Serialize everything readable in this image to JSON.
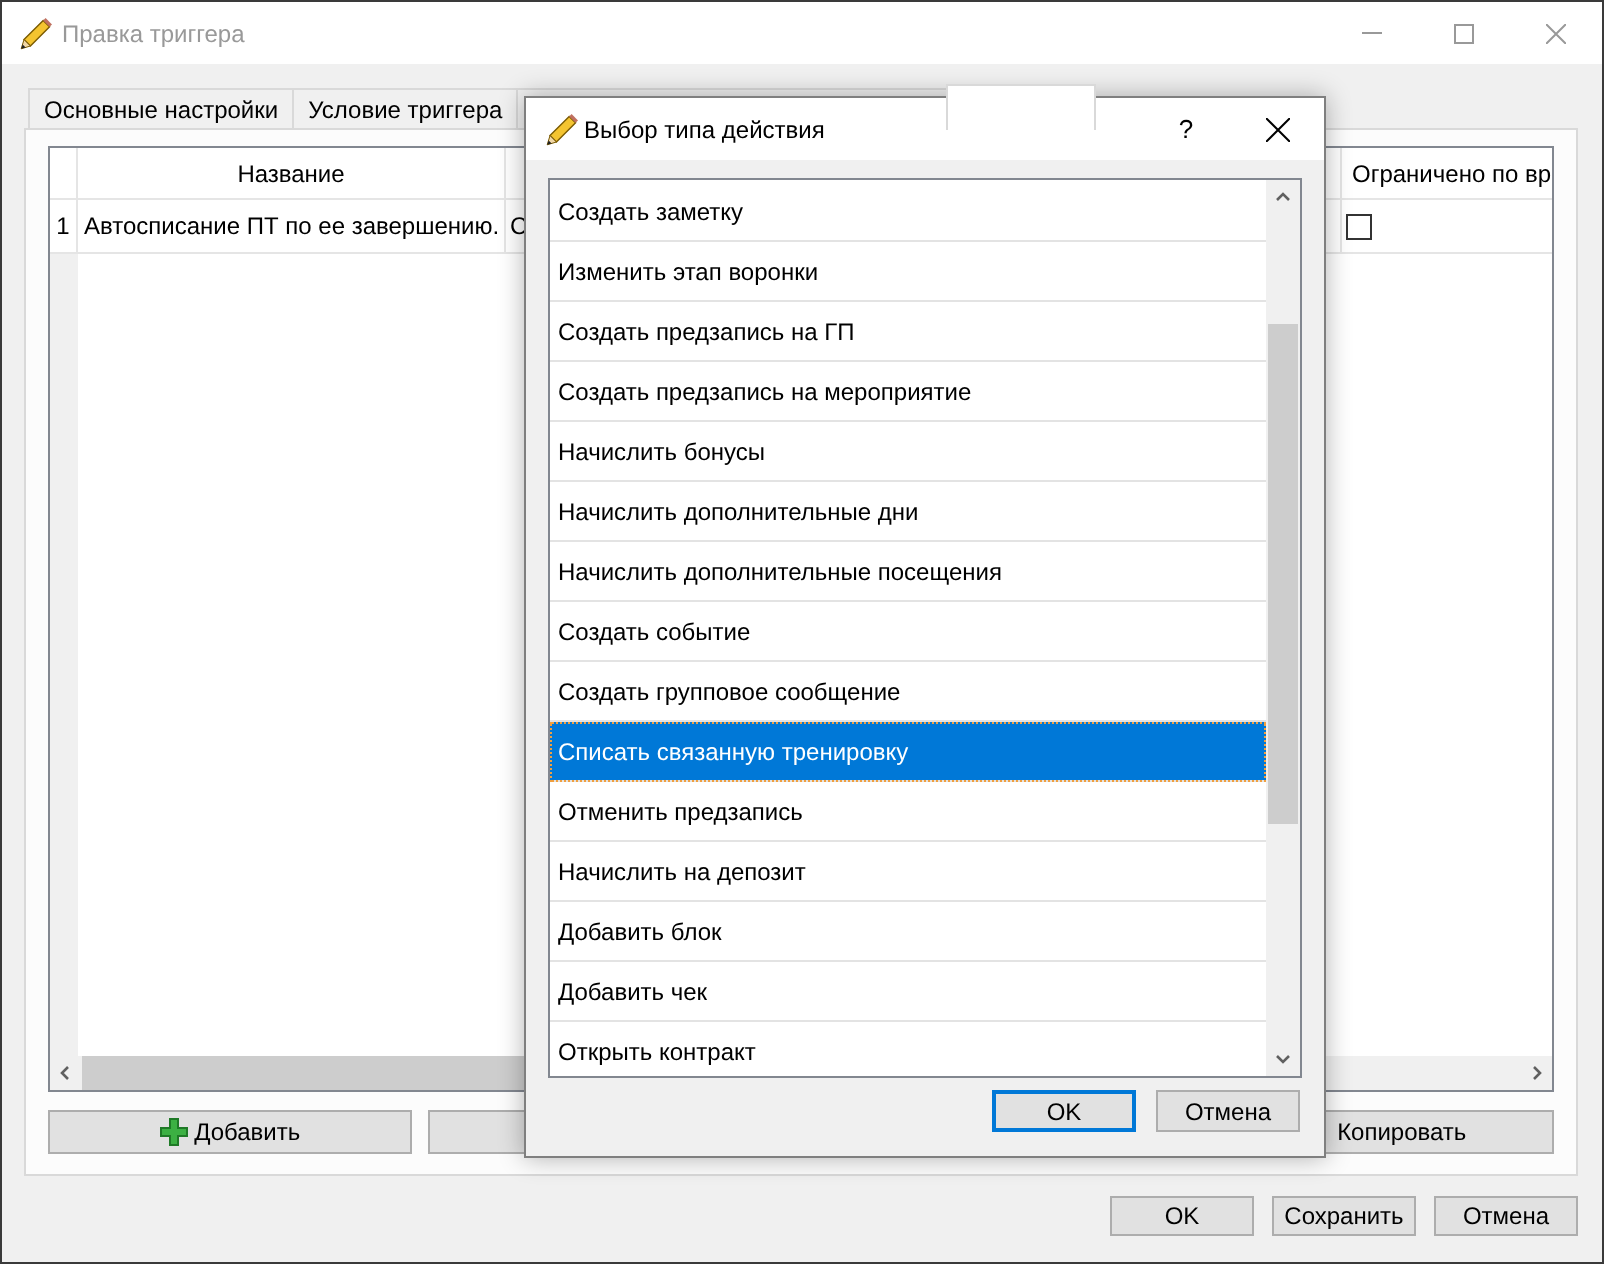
{
  "window": {
    "title": "Правка триггера",
    "active": false
  },
  "tabs": [
    {
      "label": "Основные настройки",
      "selected": false
    },
    {
      "label": "Условие триггера",
      "selected": false
    },
    {
      "selected": false
    },
    {
      "selected": true
    }
  ],
  "table": {
    "columns": [
      {
        "label": "Название",
        "kind": "text"
      },
      {
        "kind": "text"
      },
      {
        "label": "Ограничено по вр",
        "kind": "checkbox"
      }
    ],
    "rows": [
      {
        "number": "1",
        "cells": [
          {
            "text": "Автосписание ПТ по ее завершению."
          },
          {
            "text": "С"
          },
          {
            "checked": false
          }
        ]
      }
    ]
  },
  "actions": [
    {
      "kind": "add",
      "label": "Добавить"
    },
    {
      "kind": "plain"
    },
    {
      "kind": "plain",
      "label": "Копировать"
    }
  ],
  "footer_buttons": [
    {
      "label": "OK"
    },
    {
      "label": "Сохранить"
    },
    {
      "label": "Отмена"
    }
  ],
  "dialog": {
    "title": "Выбор типа действия",
    "active": true,
    "help": "?",
    "items": [
      {
        "label": "Создать заметку",
        "selected": false
      },
      {
        "label": "Изменить этап воронки",
        "selected": false
      },
      {
        "label": "Создать предзапись на ГП",
        "selected": false
      },
      {
        "label": "Создать предзапись на мероприятие",
        "selected": false
      },
      {
        "label": "Начислить бонусы",
        "selected": false
      },
      {
        "label": "Начислить дополнительные дни",
        "selected": false
      },
      {
        "label": "Начислить дополнительные посещения",
        "selected": false
      },
      {
        "label": "Создать событие",
        "selected": false
      },
      {
        "label": "Создать групповое сообщение",
        "selected": false
      },
      {
        "label": "Списать связанную тренировку",
        "selected": true
      },
      {
        "label": "Отменить предзапись",
        "selected": false
      },
      {
        "label": "Начислить на депозит",
        "selected": false
      },
      {
        "label": "Добавить блок",
        "selected": false
      },
      {
        "label": "Добавить чек",
        "selected": false
      },
      {
        "label": "Открыть контракт",
        "selected": false
      }
    ],
    "buttons": [
      {
        "label": "OK",
        "default": true
      },
      {
        "label": "Отмена",
        "default": false
      }
    ]
  }
}
